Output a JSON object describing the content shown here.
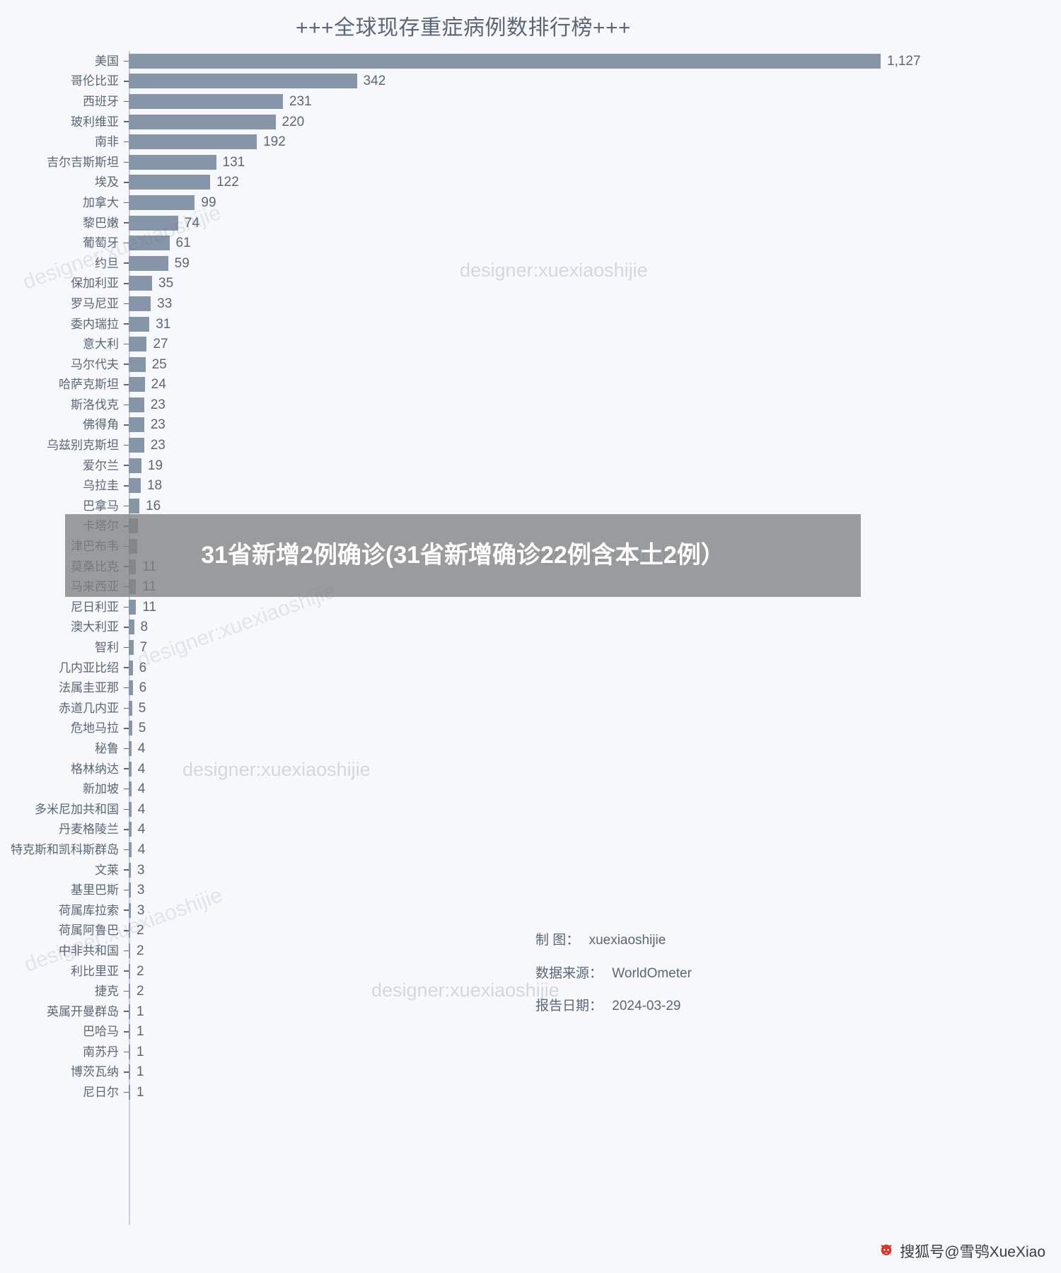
{
  "chart_data": {
    "type": "bar",
    "orientation": "horizontal",
    "title": "+++全球现存重症病例数排行榜+++",
    "xlabel": "",
    "ylabel": "",
    "grid": false,
    "legend": null,
    "xlim": [
      0,
      1127
    ],
    "categories": [
      "美国",
      "哥伦比亚",
      "西班牙",
      "玻利维亚",
      "南非",
      "吉尔吉斯斯坦",
      "埃及",
      "加拿大",
      "黎巴嫩",
      "葡萄牙",
      "约旦",
      "保加利亚",
      "罗马尼亚",
      "委内瑞拉",
      "意大利",
      "马尔代夫",
      "哈萨克斯坦",
      "斯洛伐克",
      "佛得角",
      "乌兹别克斯坦",
      "爱尔兰",
      "乌拉圭",
      "巴拿马",
      "卡塔尔",
      "津巴布韦",
      "莫桑比克",
      "马来西亚",
      "尼日利亚",
      "澳大利亚",
      "智利",
      "几内亚比绍",
      "法属圭亚那",
      "赤道几内亚",
      "危地马拉",
      "秘鲁",
      "格林纳达",
      "新加坡",
      "多米尼加共和国",
      "丹麦格陵兰",
      "特克斯和凯科斯群岛",
      "文莱",
      "基里巴斯",
      "荷属库拉索",
      "荷属阿鲁巴",
      "中非共和国",
      "利比里亚",
      "捷克",
      "英属开曼群岛",
      "巴哈马",
      "南苏丹",
      "博茨瓦纳",
      "尼日尔"
    ],
    "values": [
      1127,
      342,
      231,
      220,
      192,
      131,
      122,
      99,
      74,
      61,
      59,
      35,
      33,
      31,
      27,
      25,
      24,
      23,
      23,
      23,
      19,
      18,
      16,
      14,
      13,
      11,
      11,
      11,
      8,
      7,
      6,
      6,
      5,
      5,
      4,
      4,
      4,
      4,
      4,
      4,
      3,
      3,
      3,
      2,
      2,
      2,
      2,
      1,
      1,
      1,
      1,
      1
    ],
    "value_labels": [
      "1,127",
      "342",
      "231",
      "220",
      "192",
      "131",
      "122",
      "99",
      "74",
      "61",
      "59",
      "35",
      "33",
      "31",
      "27",
      "25",
      "24",
      "23",
      "23",
      "23",
      "19",
      "18",
      "16",
      "",
      "",
      "11",
      "11",
      "11",
      "8",
      "7",
      "6",
      "6",
      "5",
      "5",
      "4",
      "4",
      "4",
      "4",
      "4",
      "4",
      "3",
      "3",
      "3",
      "2",
      "2",
      "2",
      "2",
      "1",
      "1",
      "1",
      "1",
      "1"
    ],
    "bar_color": "#8795a8",
    "background_color": "#f6f8fc",
    "text_color": "#5b6678"
  },
  "meta": {
    "designer_key": "制      图：",
    "designer_value": "xuexiaoshijie",
    "source_key": "数据来源：",
    "source_value": "WorldOmeter",
    "date_key": "报告日期：",
    "date_value": "2024-03-29"
  },
  "watermarks": {
    "text": "designer:xuexiaoshijie",
    "instances": [
      {
        "text": "designer:xuexiaoshijie",
        "rotated": true
      },
      {
        "text": "designer:xuexiaoshijie",
        "rotated": false
      }
    ]
  },
  "overlay": {
    "caption": "31省新增2例确诊(31省新增确诊22例含本土2例）"
  },
  "footer": {
    "platform_label": "搜狐号@雪鸮XueXiao",
    "fox_icon": "sohu-fox-icon"
  }
}
